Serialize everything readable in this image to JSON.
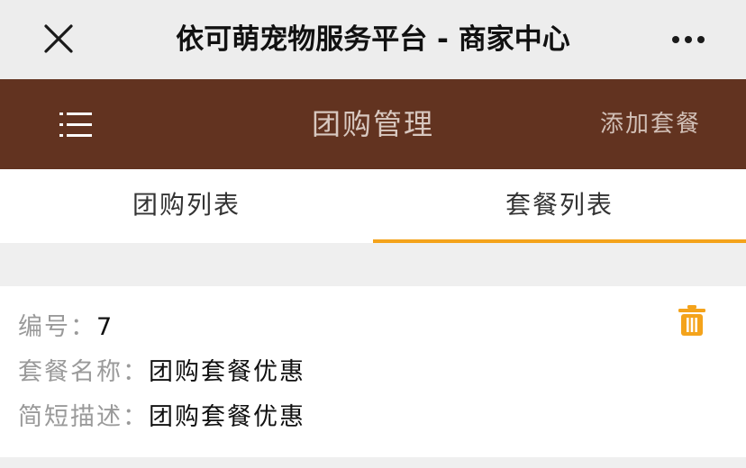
{
  "wechat_bar": {
    "title": "依可萌宠物服务平台 - 商家中心",
    "close_icon": "close-icon",
    "more_icon": "more-dots-icon"
  },
  "header": {
    "menu_icon": "menu-icon",
    "title": "团购管理",
    "add_label": "添加套餐",
    "background_color": "#623320"
  },
  "tabs": [
    {
      "label": "团购列表",
      "active": false
    },
    {
      "label": "套餐列表",
      "active": true
    }
  ],
  "accent_color": "#f4a31b",
  "package": {
    "id_label": "编号：",
    "id_value": "7",
    "name_label": "套餐名称：",
    "name_value": "团购套餐优惠",
    "desc_label": "简短描述：",
    "desc_value": "团购套餐优惠",
    "delete_icon": "trash-icon"
  }
}
